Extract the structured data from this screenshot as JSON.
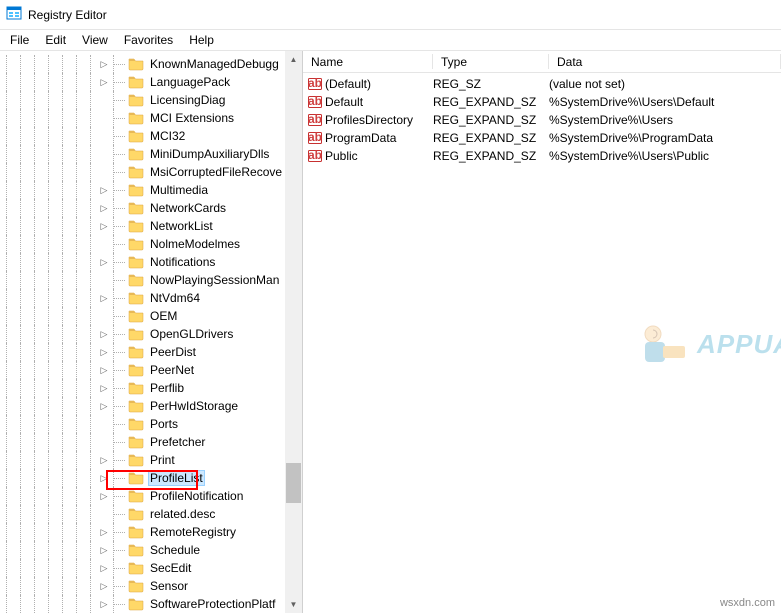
{
  "title": "Registry Editor",
  "menu": [
    "File",
    "Edit",
    "View",
    "Favorites",
    "Help"
  ],
  "tree": [
    {
      "label": "KnownManagedDebugg",
      "exp": true
    },
    {
      "label": "LanguagePack",
      "exp": true
    },
    {
      "label": "LicensingDiag",
      "exp": false
    },
    {
      "label": "MCI Extensions",
      "exp": false
    },
    {
      "label": "MCI32",
      "exp": false
    },
    {
      "label": "MiniDumpAuxiliaryDlls",
      "exp": false
    },
    {
      "label": "MsiCorruptedFileRecove",
      "exp": false
    },
    {
      "label": "Multimedia",
      "exp": true
    },
    {
      "label": "NetworkCards",
      "exp": true
    },
    {
      "label": "NetworkList",
      "exp": true
    },
    {
      "label": "NolmeModelmes",
      "exp": false
    },
    {
      "label": "Notifications",
      "exp": true
    },
    {
      "label": "NowPlayingSessionMan",
      "exp": false
    },
    {
      "label": "NtVdm64",
      "exp": true
    },
    {
      "label": "OEM",
      "exp": false
    },
    {
      "label": "OpenGLDrivers",
      "exp": true
    },
    {
      "label": "PeerDist",
      "exp": true
    },
    {
      "label": "PeerNet",
      "exp": true
    },
    {
      "label": "Perflib",
      "exp": true
    },
    {
      "label": "PerHwIdStorage",
      "exp": true
    },
    {
      "label": "Ports",
      "exp": false
    },
    {
      "label": "Prefetcher",
      "exp": false
    },
    {
      "label": "Print",
      "exp": true
    },
    {
      "label": "ProfileList",
      "exp": true,
      "sel": true
    },
    {
      "label": "ProfileNotification",
      "exp": true
    },
    {
      "label": "related.desc",
      "exp": false
    },
    {
      "label": "RemoteRegistry",
      "exp": true
    },
    {
      "label": "Schedule",
      "exp": true
    },
    {
      "label": "SecEdit",
      "exp": true
    },
    {
      "label": "Sensor",
      "exp": true
    },
    {
      "label": "SoftwareProtectionPlatf",
      "exp": true
    }
  ],
  "columns": {
    "name": "Name",
    "type": "Type",
    "data": "Data"
  },
  "values": [
    {
      "name": "(Default)",
      "type": "REG_SZ",
      "data": "(value not set)"
    },
    {
      "name": "Default",
      "type": "REG_EXPAND_SZ",
      "data": "%SystemDrive%\\Users\\Default"
    },
    {
      "name": "ProfilesDirectory",
      "type": "REG_EXPAND_SZ",
      "data": "%SystemDrive%\\Users"
    },
    {
      "name": "ProgramData",
      "type": "REG_EXPAND_SZ",
      "data": "%SystemDrive%\\ProgramData"
    },
    {
      "name": "Public",
      "type": "REG_EXPAND_SZ",
      "data": "%SystemDrive%\\Users\\Public"
    }
  ],
  "watermark": "APPUALS",
  "attr": "wsxdn.com"
}
